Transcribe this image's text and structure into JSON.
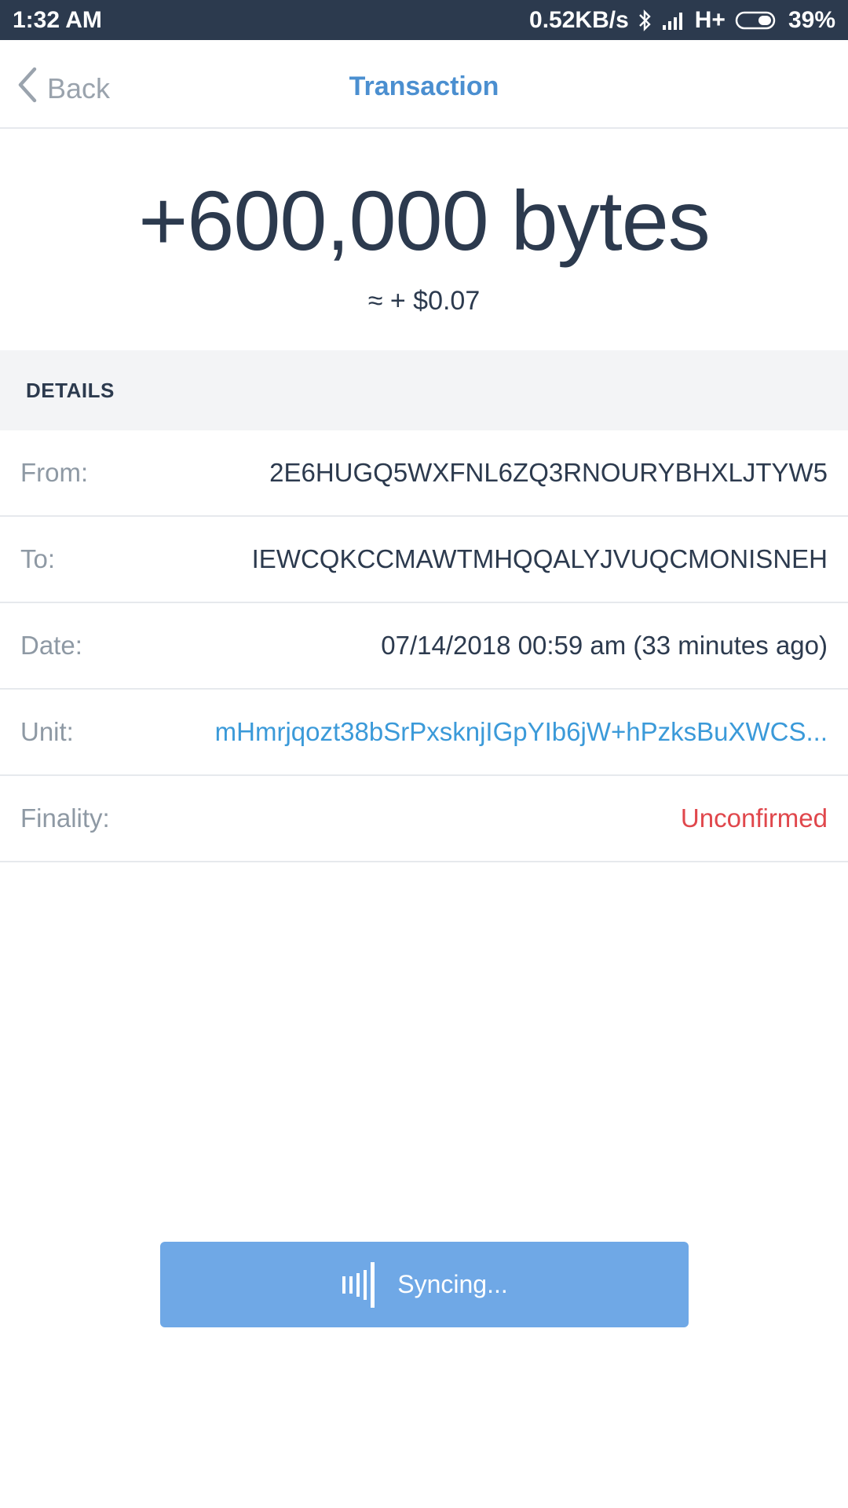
{
  "status_bar": {
    "time": "1:32 AM",
    "network_speed": "0.52KB/s",
    "network_type": "H+",
    "battery": "39%",
    "icons": [
      "bluetooth-icon",
      "signal-icon",
      "battery-icon"
    ]
  },
  "nav": {
    "back_label": "Back",
    "title": "Transaction"
  },
  "amount": {
    "main": "+600,000 bytes",
    "fiat": "≈ + $0.07"
  },
  "details": {
    "header": "DETAILS",
    "rows": [
      {
        "label": "From:",
        "value": "2E6HUGQ5WXFNL6ZQ3RNOURYBHXLJTYW5"
      },
      {
        "label": "To:",
        "value": "IEWCQKCCMAWTMHQQALYJVUQCMONISNEH"
      },
      {
        "label": "Date:",
        "value": "07/14/2018 00:59 am (33 minutes ago)"
      },
      {
        "label": "Unit:",
        "value": "mHmrjqozt38bSrPxsknjIGpYIb6jW+hPzksBuXWCS..."
      },
      {
        "label": "Finality:",
        "value": "Unconfirmed"
      }
    ]
  },
  "sync": {
    "label": "Syncing..."
  },
  "colors": {
    "status_bar_bg": "#2c3a4e",
    "accent": "#4b8fd0",
    "link": "#3b9ad9",
    "unconfirmed": "#e0474c",
    "sync_button": "#6fa8e6"
  }
}
